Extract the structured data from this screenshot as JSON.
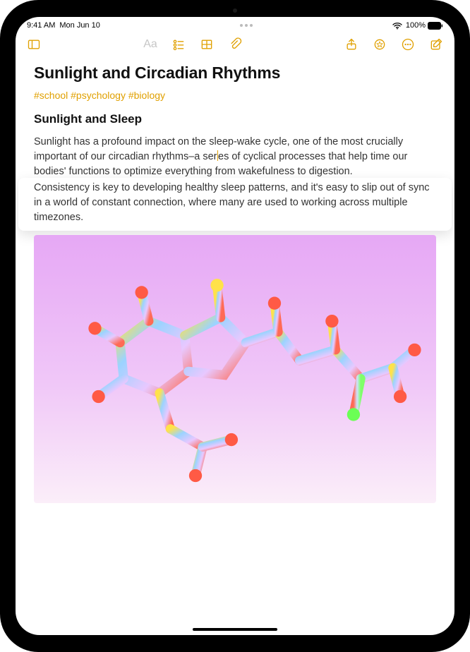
{
  "status": {
    "time": "9:41 AM",
    "date": "Mon Jun 10",
    "battery_pct": "100%"
  },
  "toolbar": {
    "sidebar": "sidebar",
    "format": "Aa",
    "checklist": "checklist",
    "table": "table",
    "attach": "attach",
    "share": "share",
    "markup": "markup",
    "more": "more",
    "compose": "compose"
  },
  "note": {
    "title": "Sunlight and Circadian Rhythms",
    "tags": "#school #psychology #biology",
    "subtitle": "Sunlight and Sleep",
    "para_top": "Sunlight has a profound impact on the sleep-wake cycle, one of the most crucially important of our circadian rhythms–a ser",
    "para_top2": "es of cyclical processes that help time our bodies' functions to optimize everything from wakefulness to digestion.",
    "para_overlay": "Consistency is key to developing healthy sleep patterns, and it's easy to slip out of sync in a world of constant connection, where many are used to working across multiple timezones."
  }
}
